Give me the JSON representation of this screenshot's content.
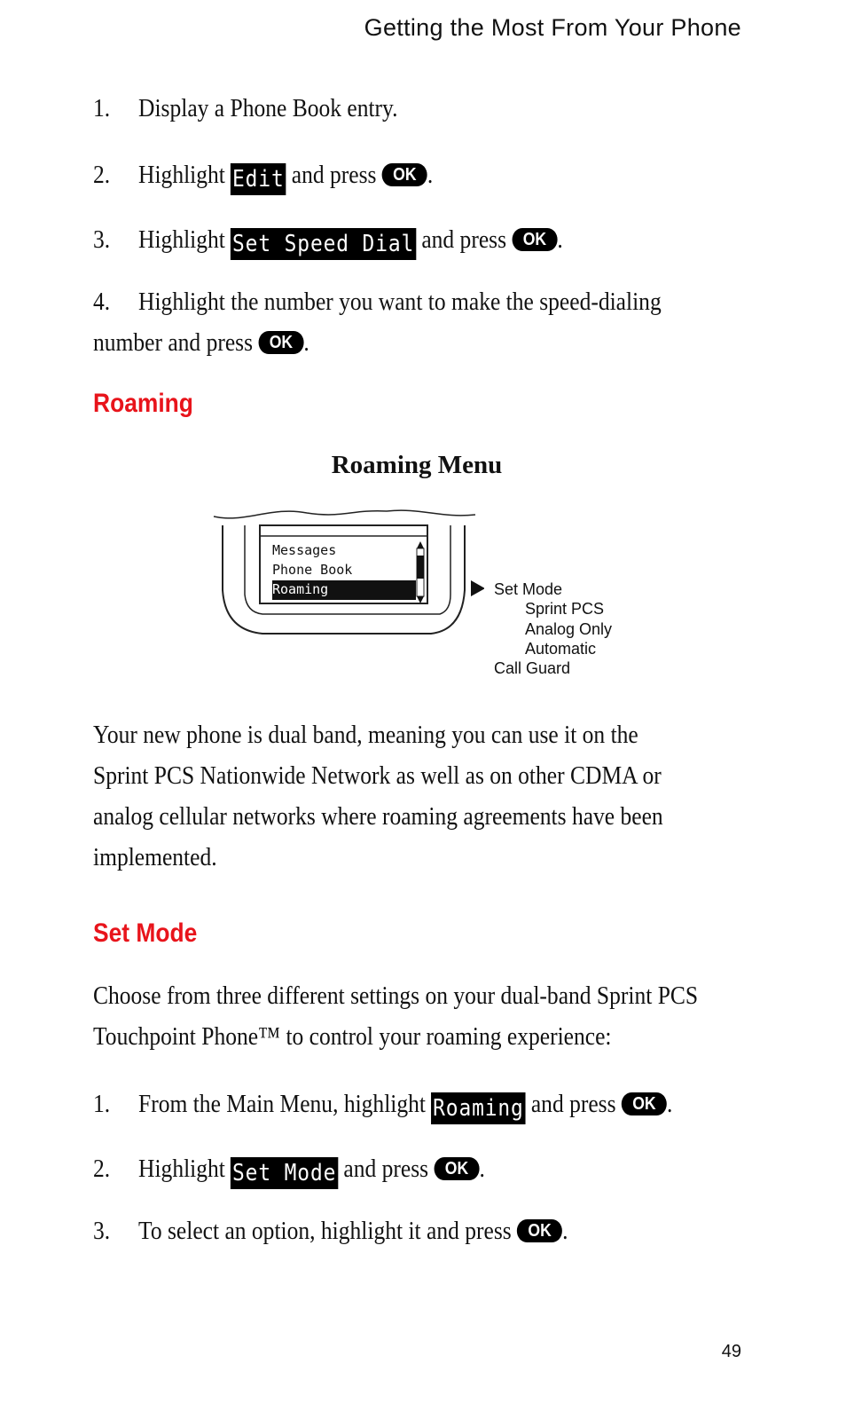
{
  "header": {
    "running_title": "Getting the Most From Your Phone"
  },
  "speed_dial_steps": [
    {
      "num": "1.",
      "text": "Display a Phone Book entry."
    },
    {
      "num": "2.",
      "pre": "Highlight",
      "lcd": "Edit",
      "post": "and press",
      "button": "OK"
    },
    {
      "num": "3.",
      "pre": "Highlight",
      "lcd": "Set Speed Dial",
      "post": "and press",
      "button": "OK"
    },
    {
      "num": "4.",
      "line1": "Highlight the number you want to make the speed-dialing",
      "line2": "number and press",
      "button": "OK"
    }
  ],
  "roaming": {
    "heading": "Roaming",
    "figure_caption": "Roaming Menu",
    "phone_screen_items": [
      "Messages",
      "Phone Book",
      "Roaming"
    ],
    "selected_item": "Roaming",
    "submenu": {
      "title": "Set Mode",
      "options": [
        "Sprint PCS",
        "Analog Only",
        "Automatic"
      ],
      "other": "Call Guard"
    },
    "body": [
      "Your new phone is dual band, meaning you can use it on the",
      "Sprint PCS Nationwide Network as well as on other CDMA or",
      "analog cellular networks where roaming agreements have been",
      "implemented."
    ]
  },
  "set_mode": {
    "heading": "Set Mode",
    "intro": [
      "Choose from three different settings on your dual-band Sprint PCS",
      "Touchpoint Phone™ to control your roaming experience:"
    ],
    "steps": [
      {
        "num": "1.",
        "pre": "From the Main Menu, highlight",
        "lcd": "Roaming",
        "post": "and press",
        "button": "OK"
      },
      {
        "num": "2.",
        "pre": "Highlight",
        "lcd": "Set Mode",
        "post": "and press",
        "button": "OK"
      },
      {
        "num": "3.",
        "pre": "To select an option, highlight it and press",
        "button": "OK"
      }
    ]
  },
  "page_number": "49",
  "colors": {
    "heading_red": "#e8141b"
  }
}
